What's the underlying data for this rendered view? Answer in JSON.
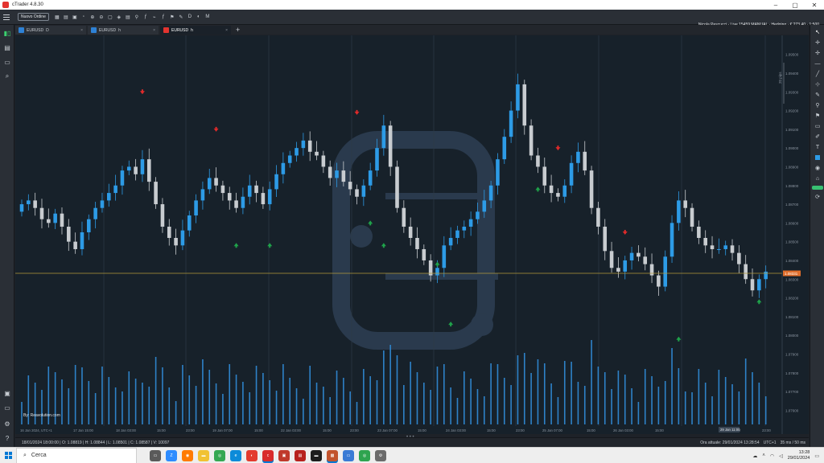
{
  "window": {
    "title": "cTrader 4.8.30"
  },
  "toolbar": {
    "new_order_label": "Nuovo Ordine",
    "account_info": "Nicola Pescucci - Live 15459 MANUAL · Hedging · € 273.40 · 1:500"
  },
  "tabs": [
    {
      "label": "EURUSD",
      "extra": "D",
      "active": false
    },
    {
      "label": "EURUSD",
      "extra": "h",
      "active": false
    },
    {
      "label": "EURUSD",
      "extra": "h",
      "active": true
    }
  ],
  "chart": {
    "price_ticks": [
      "1.09500",
      "1.09400",
      "1.09300",
      "1.09200",
      "1.09100",
      "1.09000",
      "1.08900",
      "1.08800",
      "1.08700",
      "1.08600",
      "1.08500",
      "1.08400",
      "1.08300",
      "1.08200",
      "1.08100",
      "1.08000",
      "1.07900",
      "1.07800",
      "1.07700",
      "1.07600"
    ],
    "current_price": "1.08331",
    "last_date": "29 Jan 11:00",
    "pips_label": "20 pips",
    "time_ticks": [
      "16 Jan 2024, UTC+1",
      "17 Jan 15:00",
      "18 Jan 03:00",
      "15:00",
      "23:00",
      "19 Jan 07:00",
      "15:00",
      "22 Jan 03:00",
      "15:00",
      "23:00",
      "23 Jan 07:00",
      "15:00",
      "24 Jan 03:00",
      "15:00",
      "23:00",
      "25 Jan 07:00",
      "15:00",
      "26 Jan 03:00",
      "15:00",
      "29 Jan 15:00",
      "23:00"
    ],
    "watermark_text": "By: Reavolution.com",
    "colors": {
      "bull": "#2d9be6",
      "bear": "#c8ccd0",
      "bg": "#17212a",
      "price_line": "#b59a3a",
      "price_label": "#e06e2c",
      "up_arrow": "#1fa34a",
      "down_arrow": "#e02a2a"
    },
    "up_arrows": [
      {
        "candle": 32,
        "price": 1.086
      },
      {
        "candle": 37,
        "price": 1.086
      },
      {
        "candle": 52,
        "price": 1.0872
      },
      {
        "candle": 54,
        "price": 1.086
      },
      {
        "candle": 62,
        "price": 1.085
      },
      {
        "candle": 64,
        "price": 1.0818
      },
      {
        "candle": 77,
        "price": 1.089
      },
      {
        "candle": 98,
        "price": 1.081
      },
      {
        "candle": 110,
        "price": 1.083
      }
    ],
    "down_arrows": [
      {
        "candle": 18,
        "price": 1.0922
      },
      {
        "candle": 29,
        "price": 1.0902
      },
      {
        "candle": 50,
        "price": 1.0911
      },
      {
        "candle": 80,
        "price": 1.0892
      },
      {
        "candle": 90,
        "price": 1.0847
      }
    ]
  },
  "status": {
    "ohlc": "18/01/2024 18:00:00  |  O: 1.08819  |  H: 1.08844  |  L: 1.08501  |  C: 1.08587  |  V: 10097",
    "time_label": "Ora attuale: 29/01/2024 13:28:54",
    "timezone": "UTC+1",
    "latency": "35 ms / 50 ms"
  },
  "taskbar": {
    "search_placeholder": "Cerca",
    "clock_time": "13:28",
    "clock_date": "29/01/2024"
  }
}
